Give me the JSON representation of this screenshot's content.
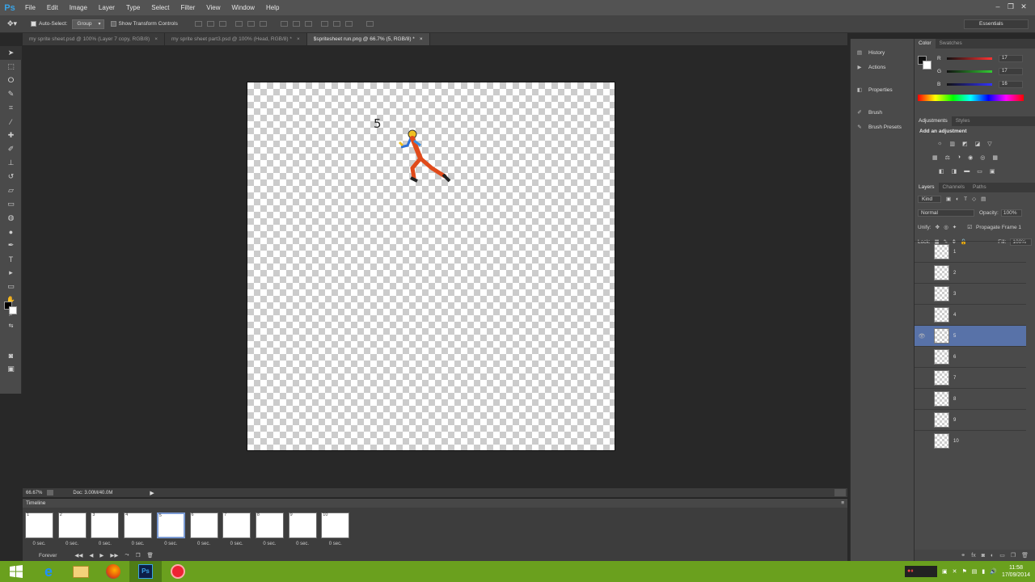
{
  "app": {
    "logo": "Ps"
  },
  "menu": [
    "File",
    "Edit",
    "Image",
    "Layer",
    "Type",
    "Select",
    "Filter",
    "View",
    "Window",
    "Help"
  ],
  "options": {
    "auto_select_label": "Auto-Select:",
    "auto_select_value": "Group",
    "transform_label": "Show Transform Controls",
    "workspace": "Essentials"
  },
  "tabs": [
    {
      "label": "my sprite sheet.psd @ 100% (Layer 7 copy, RGB/8)",
      "close": "×",
      "active": false
    },
    {
      "label": "my sprite sheet part3.psd @ 100% (Head, RGB/8) *",
      "close": "×",
      "active": false
    },
    {
      "label": "$spritesheet run.png @ 66.7% (5, RGB/8) *",
      "close": "×",
      "active": true
    }
  ],
  "canvas": {
    "frame_label": "5"
  },
  "status": {
    "zoom": "66.67%",
    "doc": "Doc: 3.00M/40.0M"
  },
  "timeline": {
    "title": "Timeline",
    "frames": [
      {
        "num": "1",
        "delay": "0 sec."
      },
      {
        "num": "2",
        "delay": "0 sec."
      },
      {
        "num": "3",
        "delay": "0 sec."
      },
      {
        "num": "4",
        "delay": "0 sec."
      },
      {
        "num": "5",
        "delay": "0 sec."
      },
      {
        "num": "6",
        "delay": "0 sec."
      },
      {
        "num": "7",
        "delay": "0 sec."
      },
      {
        "num": "8",
        "delay": "0 sec."
      },
      {
        "num": "9",
        "delay": "0 sec."
      },
      {
        "num": "10",
        "delay": "0 sec."
      }
    ],
    "selected_frame": "5",
    "loop": "Forever"
  },
  "dock": [
    "History",
    "Actions",
    "Properties",
    "Brush",
    "Brush Presets"
  ],
  "color_panel": {
    "tabs": [
      "Color",
      "Swatches"
    ],
    "r": "17",
    "g": "17",
    "b": "16",
    "r_label": "R",
    "g_label": "G",
    "b_label": "B"
  },
  "adjustments": {
    "tabs": [
      "Adjustments",
      "Styles"
    ],
    "title": "Add an adjustment"
  },
  "layers_panel": {
    "tabs": [
      "Layers",
      "Channels",
      "Paths"
    ],
    "kind": "Kind",
    "blend": "Normal",
    "opacity_label": "Opacity:",
    "opacity": "100%",
    "unify_label": "Unify:",
    "propagate": "Propagate Frame 1",
    "lock_label": "Lock:",
    "fill_label": "Fill:",
    "fill": "100%",
    "layers": [
      "1",
      "2",
      "3",
      "4",
      "5",
      "6",
      "7",
      "8",
      "9",
      "10"
    ],
    "selected": "5"
  },
  "taskbar": {
    "time": "11:58",
    "date": "17/09/2014"
  },
  "colors": {
    "accent": "#5872a8",
    "taskbar": "#6aa01e"
  }
}
